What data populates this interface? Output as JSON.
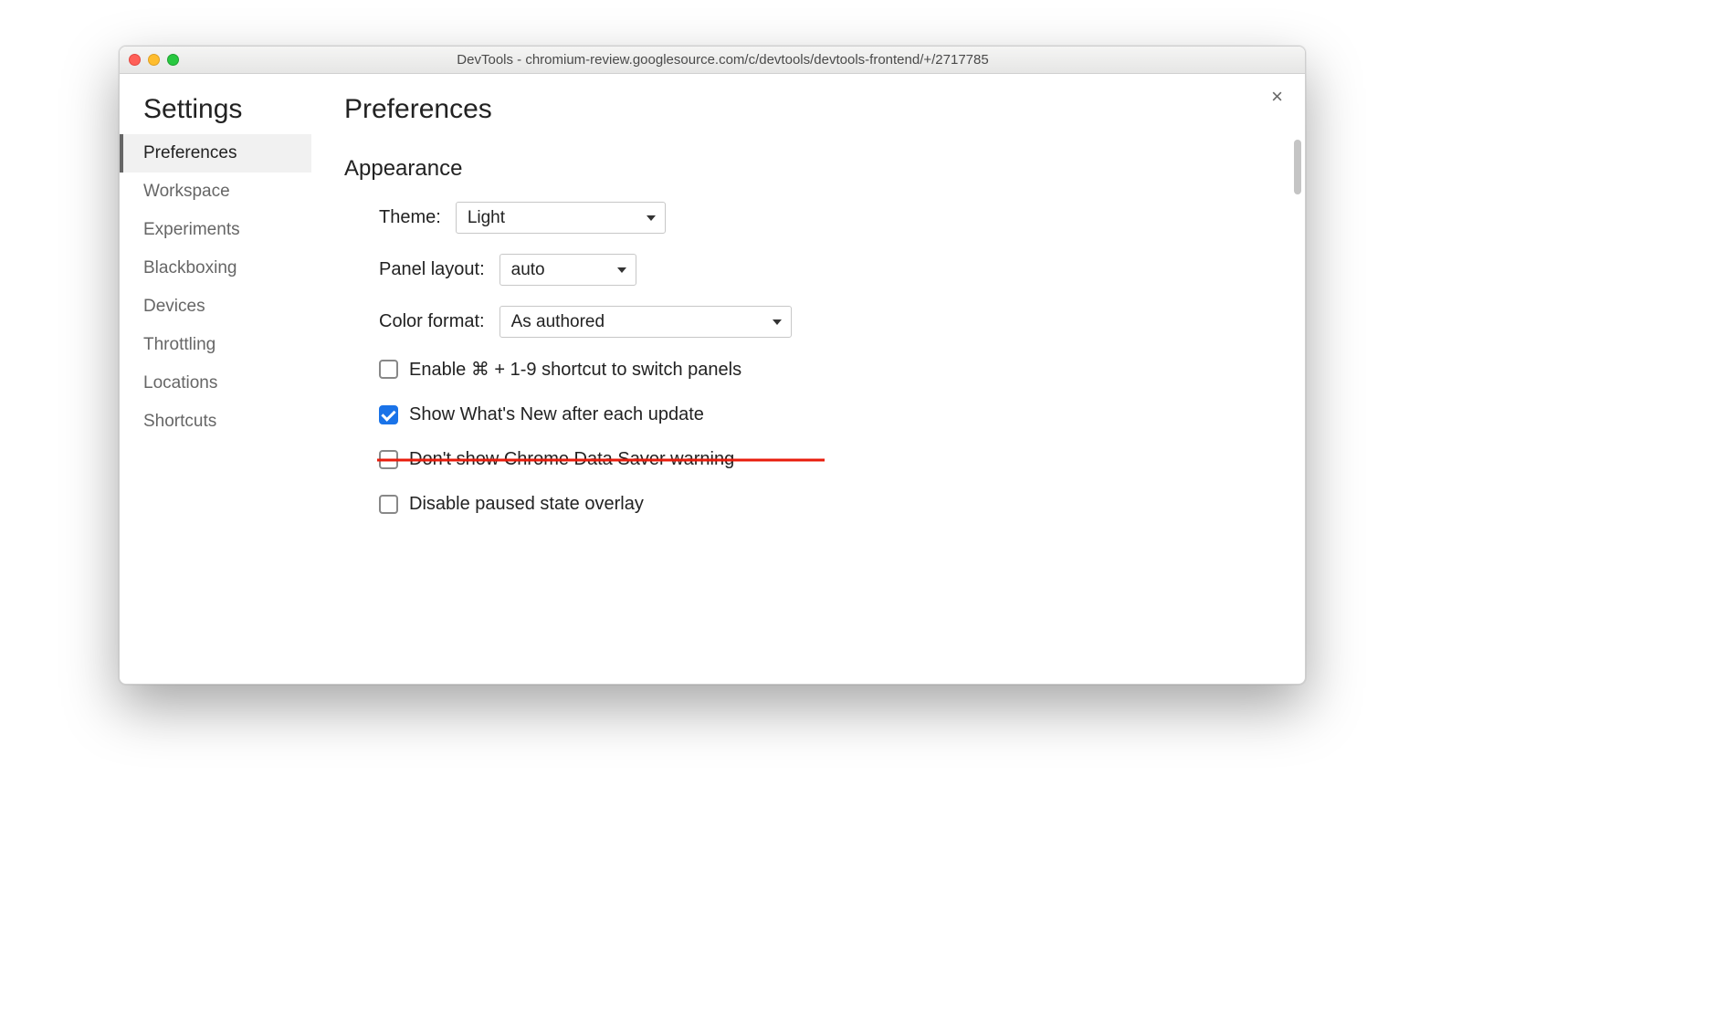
{
  "window": {
    "title": "DevTools - chromium-review.googlesource.com/c/devtools/devtools-frontend/+/2717785"
  },
  "sidebar": {
    "heading": "Settings",
    "items": [
      {
        "label": "Preferences",
        "active": true
      },
      {
        "label": "Workspace",
        "active": false
      },
      {
        "label": "Experiments",
        "active": false
      },
      {
        "label": "Blackboxing",
        "active": false
      },
      {
        "label": "Devices",
        "active": false
      },
      {
        "label": "Throttling",
        "active": false
      },
      {
        "label": "Locations",
        "active": false
      },
      {
        "label": "Shortcuts",
        "active": false
      }
    ]
  },
  "main": {
    "title": "Preferences",
    "close_label": "×",
    "appearance": {
      "section_title": "Appearance",
      "theme_label": "Theme:",
      "theme_value": "Light",
      "panel_label": "Panel layout:",
      "panel_value": "auto",
      "color_label": "Color format:",
      "color_value": "As authored",
      "checkboxes": [
        {
          "label": "Enable ⌘ + 1-9 shortcut to switch panels",
          "checked": false,
          "struck": false
        },
        {
          "label": "Show What's New after each update",
          "checked": true,
          "struck": false
        },
        {
          "label": "Don't show Chrome Data Saver warning",
          "checked": false,
          "struck": true
        },
        {
          "label": "Disable paused state overlay",
          "checked": false,
          "struck": false
        }
      ]
    }
  }
}
